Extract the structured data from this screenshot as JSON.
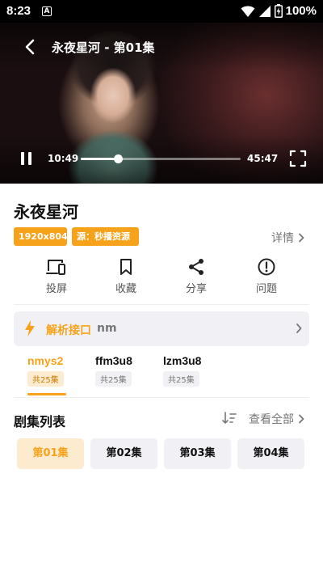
{
  "status_bar": {
    "time": "8:23",
    "notification_badge": "A",
    "battery_percent": "100%"
  },
  "player": {
    "title": "永夜星河 - 第01集",
    "current_time": "10:49",
    "total_time": "45:47",
    "progress": 0.23
  },
  "show": {
    "title": "永夜星河",
    "tags": {
      "resolution": "1920x804",
      "source": "源：秒播资源"
    },
    "detail_label": "详情"
  },
  "actions": [
    {
      "label": "投屏",
      "icon": "cast-icon"
    },
    {
      "label": "收藏",
      "icon": "bookmark-icon"
    },
    {
      "label": "分享",
      "icon": "share-icon"
    },
    {
      "label": "问题",
      "icon": "alert-icon"
    }
  ],
  "parser": {
    "label": "解析接口",
    "value": "nm"
  },
  "sources": [
    {
      "name": "nmys2",
      "count": "共25集",
      "active": true
    },
    {
      "name": "ffm3u8",
      "count": "共25集",
      "active": false
    },
    {
      "name": "lzm3u8",
      "count": "共25集",
      "active": false
    }
  ],
  "episodes": {
    "title": "剧集列表",
    "view_all_label": "查看全部",
    "items": [
      "第01集",
      "第02集",
      "第03集",
      "第04集"
    ],
    "active_index": 0
  },
  "colors": {
    "accent": "#f7a21b",
    "accent_bg": "#fdebd0",
    "chip_bg": "#f1f1f5"
  }
}
